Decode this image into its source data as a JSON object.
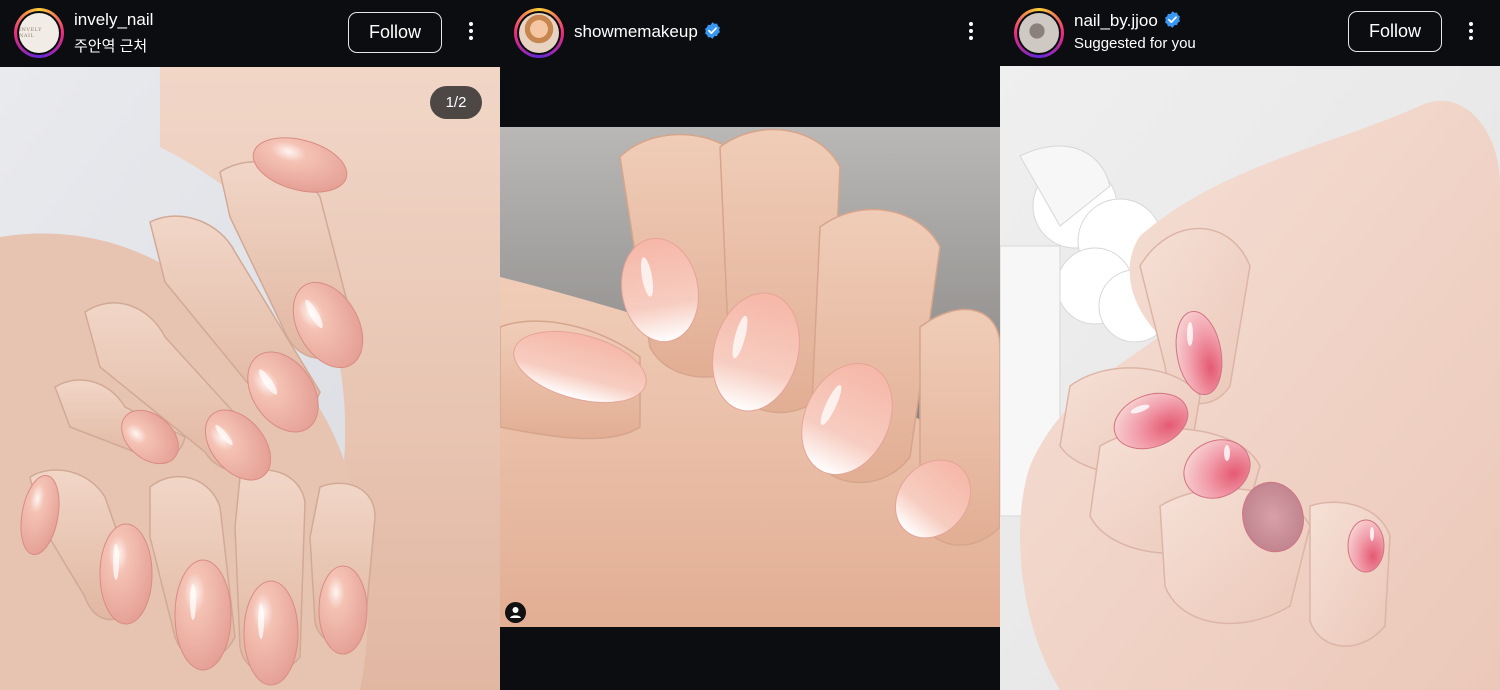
{
  "posts": [
    {
      "username": "invely_nail",
      "subtitle": "주안역 근처",
      "avatar_text": "INVELY NAIL",
      "follow_label": "Follow",
      "media_counter": "1/2",
      "icons": [
        "more-vertical-icon"
      ]
    },
    {
      "username": "showmemakeup",
      "verified": true,
      "icons": [
        "verified-badge-icon",
        "more-vertical-icon",
        "tagged-user-icon"
      ]
    },
    {
      "username": "nail_by.jjoo",
      "verified": true,
      "subtitle": "Suggested for you",
      "follow_label": "Follow",
      "icons": [
        "verified-badge-icon",
        "more-vertical-icon"
      ]
    }
  ],
  "colors": {
    "background": "#0b0d10",
    "verified": "#3897f0",
    "skin": "#e8c0aa",
    "nail_pink": "#f3b6ad"
  }
}
